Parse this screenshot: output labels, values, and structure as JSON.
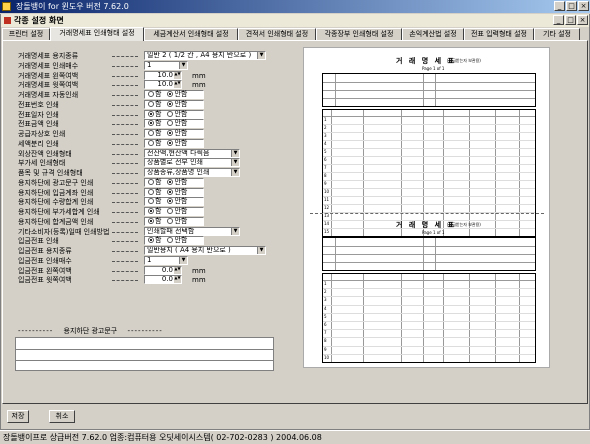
{
  "window": {
    "title": "장돌뱅이 for 윈도우 버전 7.62.0",
    "min": "_",
    "max": "□",
    "close": "×"
  },
  "inner": {
    "title": "각종 설정 화면",
    "min": "_",
    "max": "□",
    "close": "×"
  },
  "tabs": [
    "프린터 설정",
    "거래명세표 인쇄형태 설정",
    "세금계산서 인쇄형태 설정",
    "견적서 인쇄형태 설정",
    "각종장부 인쇄형태 설정",
    "손익계산법 설정",
    "전표 입력형태 설정",
    "기타 설정"
  ],
  "form": {
    "rows": [
      {
        "label": "거래명세표 용지종류",
        "value": "일반 2 ( 1/2 칸 , A4 용지 반으로 )"
      },
      {
        "label": "거래명세표 인쇄매수",
        "value": "1"
      },
      {
        "label": "거래명세표 왼쪽여백",
        "value": "10.0",
        "unit": "mm"
      },
      {
        "label": "거래명세표 윗쪽여백",
        "value": "10.0",
        "unit": "mm"
      },
      {
        "label": "거래명세표 자동인쇄",
        "opt1": "함",
        "opt2": "안함"
      },
      {
        "label": "전표번호 인쇄",
        "opt1": "함",
        "opt2": "안함"
      },
      {
        "label": "전표일자 인쇄",
        "opt1": "함",
        "opt2": "안함"
      },
      {
        "label": "전표금액 인쇄",
        "opt1": "함",
        "opt2": "안함"
      },
      {
        "label": "공급자상호 인쇄",
        "opt1": "함",
        "opt2": "안함"
      },
      {
        "label": "세액분리 인쇄",
        "opt1": "함",
        "opt2": "안함"
      },
      {
        "label": "외상잔액 인쇄형태",
        "value": "전잔액,현잔액 다찍음"
      },
      {
        "label": "부가세 인쇄형태",
        "value": "상품별로 전부 인쇄"
      },
      {
        "label": "품목 및 규격 인쇄형태",
        "value": "상품종류,상품명 인쇄"
      },
      {
        "label": "용지하단에 광고문구 인쇄",
        "opt1": "함",
        "opt2": "안함"
      },
      {
        "label": "용지하단에 입금계좌 인쇄",
        "opt1": "함",
        "opt2": "안함"
      },
      {
        "label": "용지하단에 수량합계 인쇄",
        "opt1": "함",
        "opt2": "안함"
      },
      {
        "label": "용지하단에 부가세합계 인쇄",
        "opt1": "함",
        "opt2": "안함"
      },
      {
        "label": "용지하단에 합계금액 인쇄",
        "opt1": "함",
        "opt2": "안함"
      },
      {
        "label": "기타소비자(등록)일때 인쇄방법",
        "value": "인쇄할때 선택함"
      },
      {
        "label": "입금전표 인쇄",
        "opt1": "함",
        "opt2": "안함"
      },
      {
        "label": "입금전표 용지종류",
        "value": "일반용지 ( A4 용지 반으로 )"
      },
      {
        "label": "입금전표 인쇄매수",
        "value": "1"
      },
      {
        "label": "입금전표 왼쪽여백",
        "value": "0.0",
        "unit": "mm"
      },
      {
        "label": "입금전표 윗쪽여백",
        "value": "0.0",
        "unit": "mm"
      }
    ],
    "radio_selected": [
      2,
      2,
      1,
      1,
      2,
      2,
      null,
      null,
      null,
      1,
      1,
      1,
      1,
      1,
      null,
      2
    ],
    "memo_label": "용지하단 광고문구"
  },
  "preview": {
    "title": "거 래 명 세 표",
    "page": "Page 1 of 1",
    "subtitle": "(공급받는자 보관용)",
    "row_numbers": [
      "1",
      "2",
      "3",
      "4",
      "5",
      "6",
      "7",
      "8",
      "9",
      "10",
      "11",
      "12",
      "13",
      "14",
      "15"
    ]
  },
  "buttons": {
    "save": "저장",
    "cancel": "취소"
  },
  "status": "장돌뱅이프로 상급버전  7.62.0   업종:컴퓨터용   오딧세이시스템( 02-702-0283 )   2004.06.08"
}
